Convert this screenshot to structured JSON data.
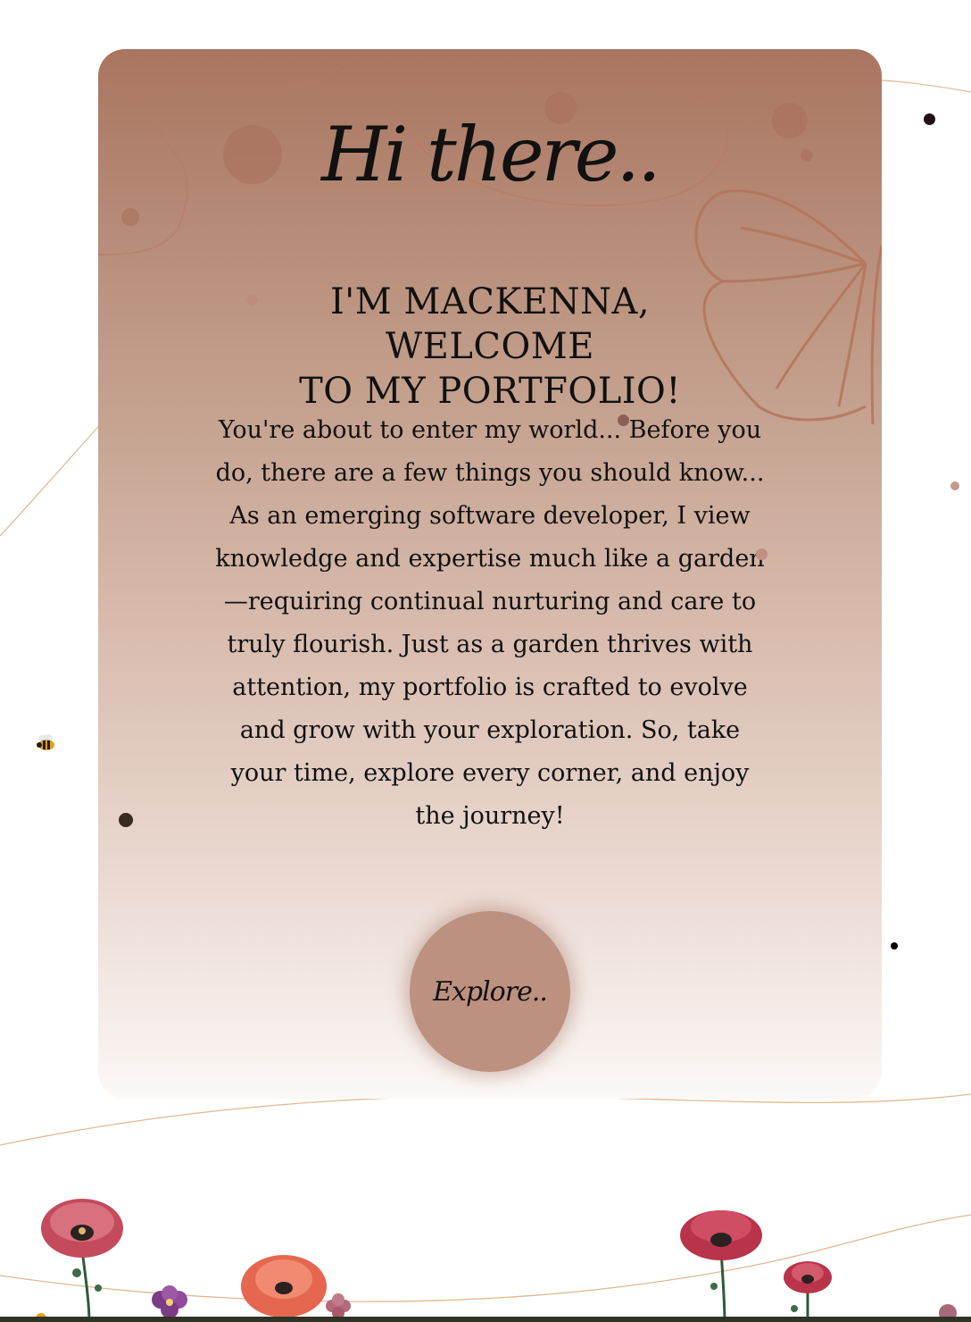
{
  "hero": {
    "greeting": "Hi there..",
    "headline_line1": "I'M MACKENNA, WELCOME",
    "headline_line2": "TO MY PORTFOLIO!",
    "intro": "You're about to enter my world... Before you do, there are a few things you should know... As an emerging software developer, I view knowledge and expertise much like a garden—requiring continual nurturing and care to truly flourish. Just as a garden thrives with attention, my portfolio is crafted to evolve and grow with your exploration. So, take your time, explore every corner, and enjoy the journey!",
    "explore_label": "Explore.."
  },
  "colors": {
    "card_top": "#a97560",
    "card_bottom": "#fbf8f6",
    "button": "#bd917f",
    "line_accent": "#e2b890",
    "outline_flower": "#b77a62"
  },
  "icons": [
    "bee-icon",
    "poppy-flower-icon",
    "violet-flower-icon",
    "butterfly-outline-icon"
  ]
}
